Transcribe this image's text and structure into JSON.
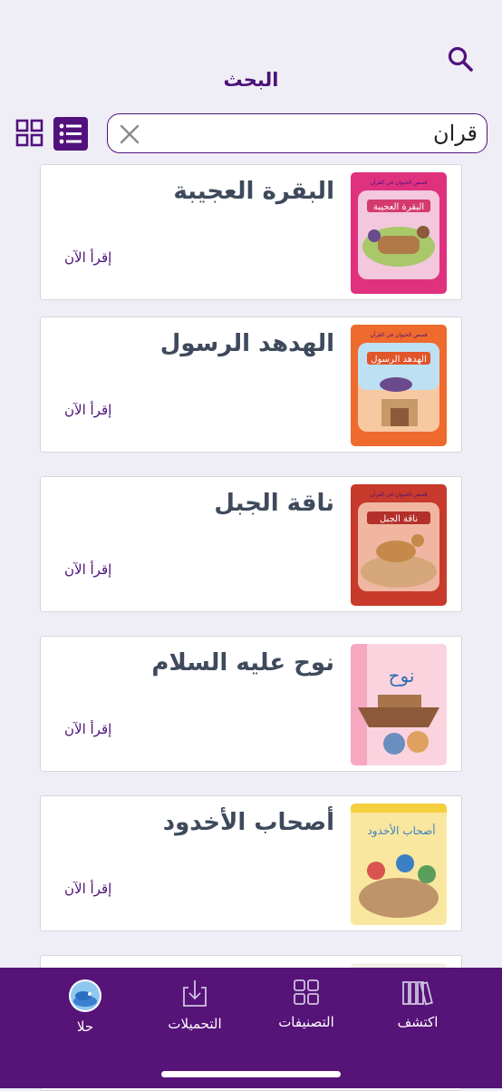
{
  "header": {
    "title": "البحث",
    "search": {
      "value": "قران",
      "placeholder": ""
    }
  },
  "books": [
    {
      "title": "البقرة العجيبة",
      "action": "إقرأ الآن",
      "cover": {
        "series": "قصص الحيوان في القرآن",
        "cover_title": "البقرة العجيبة",
        "frame": "#e0317f",
        "bg": "#f3c7dc",
        "accent": "#d43a6f"
      }
    },
    {
      "title": "الهدهد الرسول",
      "action": "إقرأ الآن",
      "cover": {
        "series": "قصص الحيوان في القرآن",
        "cover_title": "الهدهد الرسول",
        "frame": "#ef6a2d",
        "bg": "#f7c8a2",
        "accent": "#e2542a"
      }
    },
    {
      "title": "ناقة الجبل",
      "action": "إقرأ الآن",
      "cover": {
        "series": "قصص الحيوان في القرآن",
        "cover_title": "ناقة الجبل",
        "frame": "#c83a2b",
        "bg": "#f0b6a2",
        "accent": "#b3302a"
      }
    },
    {
      "title": "نوح عليه السلام",
      "action": "إقرأ الآن",
      "cover": {
        "series": "",
        "cover_title": "نوح",
        "frame": "#f6a8c0",
        "bg": "#fbd3df",
        "accent": "#2f6cb0"
      }
    },
    {
      "title": "أصحاب الأخدود",
      "action": "إقرأ الآن",
      "cover": {
        "series": "",
        "cover_title": "أصحاب الأخدود",
        "frame": "#f4d03f",
        "bg": "#f9e79f",
        "accent": "#3b7fc4"
      }
    },
    {
      "title": "",
      "action": "",
      "cover": {
        "series": "",
        "cover_title": "",
        "frame": "#2f8f9f",
        "bg": "#f3efe4",
        "accent": "#2f8f9f"
      }
    }
  ],
  "nav": {
    "discover": "اكتشف",
    "categories": "التصنيفات",
    "downloads": "التحميلات",
    "profile": "حلا"
  },
  "colors": {
    "brand_purple": "#52107d",
    "nav_purple": "#561378",
    "background": "#efeef6",
    "title_text": "#3e4a5c"
  },
  "icons": {
    "search": "search-icon",
    "clear": "close-icon",
    "grid_view": "grid-view-icon",
    "list_view": "list-view-icon",
    "discover": "books-icon",
    "categories": "grid-icon",
    "downloads": "download-icon",
    "profile": "avatar-icon"
  }
}
